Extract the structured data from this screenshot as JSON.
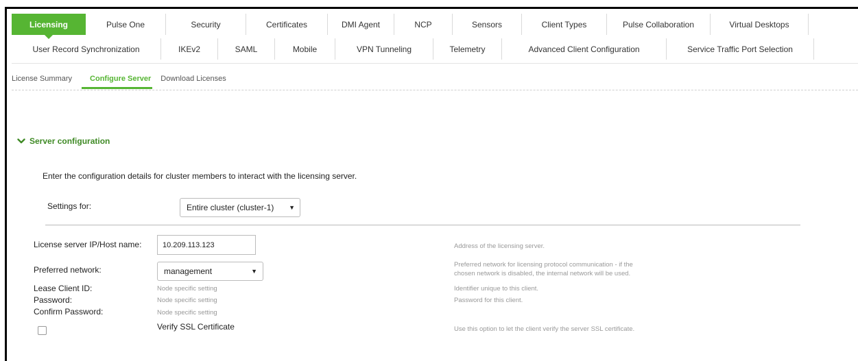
{
  "tabs_row1": [
    {
      "label": "Licensing",
      "active": true
    },
    {
      "label": "Pulse One"
    },
    {
      "label": "Security"
    },
    {
      "label": "Certificates"
    },
    {
      "label": "DMI Agent"
    },
    {
      "label": "NCP"
    },
    {
      "label": "Sensors"
    },
    {
      "label": "Client Types"
    },
    {
      "label": "Pulse Collaboration"
    },
    {
      "label": "Virtual Desktops"
    }
  ],
  "tabs_row2": [
    {
      "label": "User Record Synchronization"
    },
    {
      "label": "IKEv2"
    },
    {
      "label": "SAML"
    },
    {
      "label": "Mobile"
    },
    {
      "label": "VPN Tunneling"
    },
    {
      "label": "Telemetry"
    },
    {
      "label": "Advanced Client Configuration"
    },
    {
      "label": "Service Traffic Port Selection"
    }
  ],
  "subtabs": [
    {
      "label": "License Summary"
    },
    {
      "label": "Configure Server",
      "active": true
    },
    {
      "label": "Download Licenses"
    }
  ],
  "section": {
    "title": "Server configuration",
    "icon": "chevron-down-icon"
  },
  "intro": "Enter the configuration details for cluster members to interact with the licensing server.",
  "settings_for": {
    "label": "Settings for:",
    "selected": "Entire cluster (cluster-1)"
  },
  "form": {
    "ip_label": "License server IP/Host name:",
    "ip_value": "10.209.113.123",
    "ip_help": "Address of the licensing server.",
    "network_label": "Preferred network:",
    "network_selected": "management",
    "network_help_line1": "Preferred network for licensing protocol communication - if the",
    "network_help_line2": "chosen network is disabled, the internal network will be used.",
    "lease_label": "Lease Client ID:",
    "lease_value": "Node specific setting",
    "lease_help": "Identifier unique to this client.",
    "password_label": "Password:",
    "password_value": "Node specific setting",
    "password_help": "Password for this client.",
    "confirm_label": "Confirm Password:",
    "confirm_value": "Node specific setting",
    "verify_label": "Verify SSL Certificate",
    "verify_checked": false,
    "verify_help": "Use this option to let the client verify the server SSL certificate."
  },
  "colors": {
    "accent": "#56b533",
    "section_title": "#3f8a25"
  }
}
